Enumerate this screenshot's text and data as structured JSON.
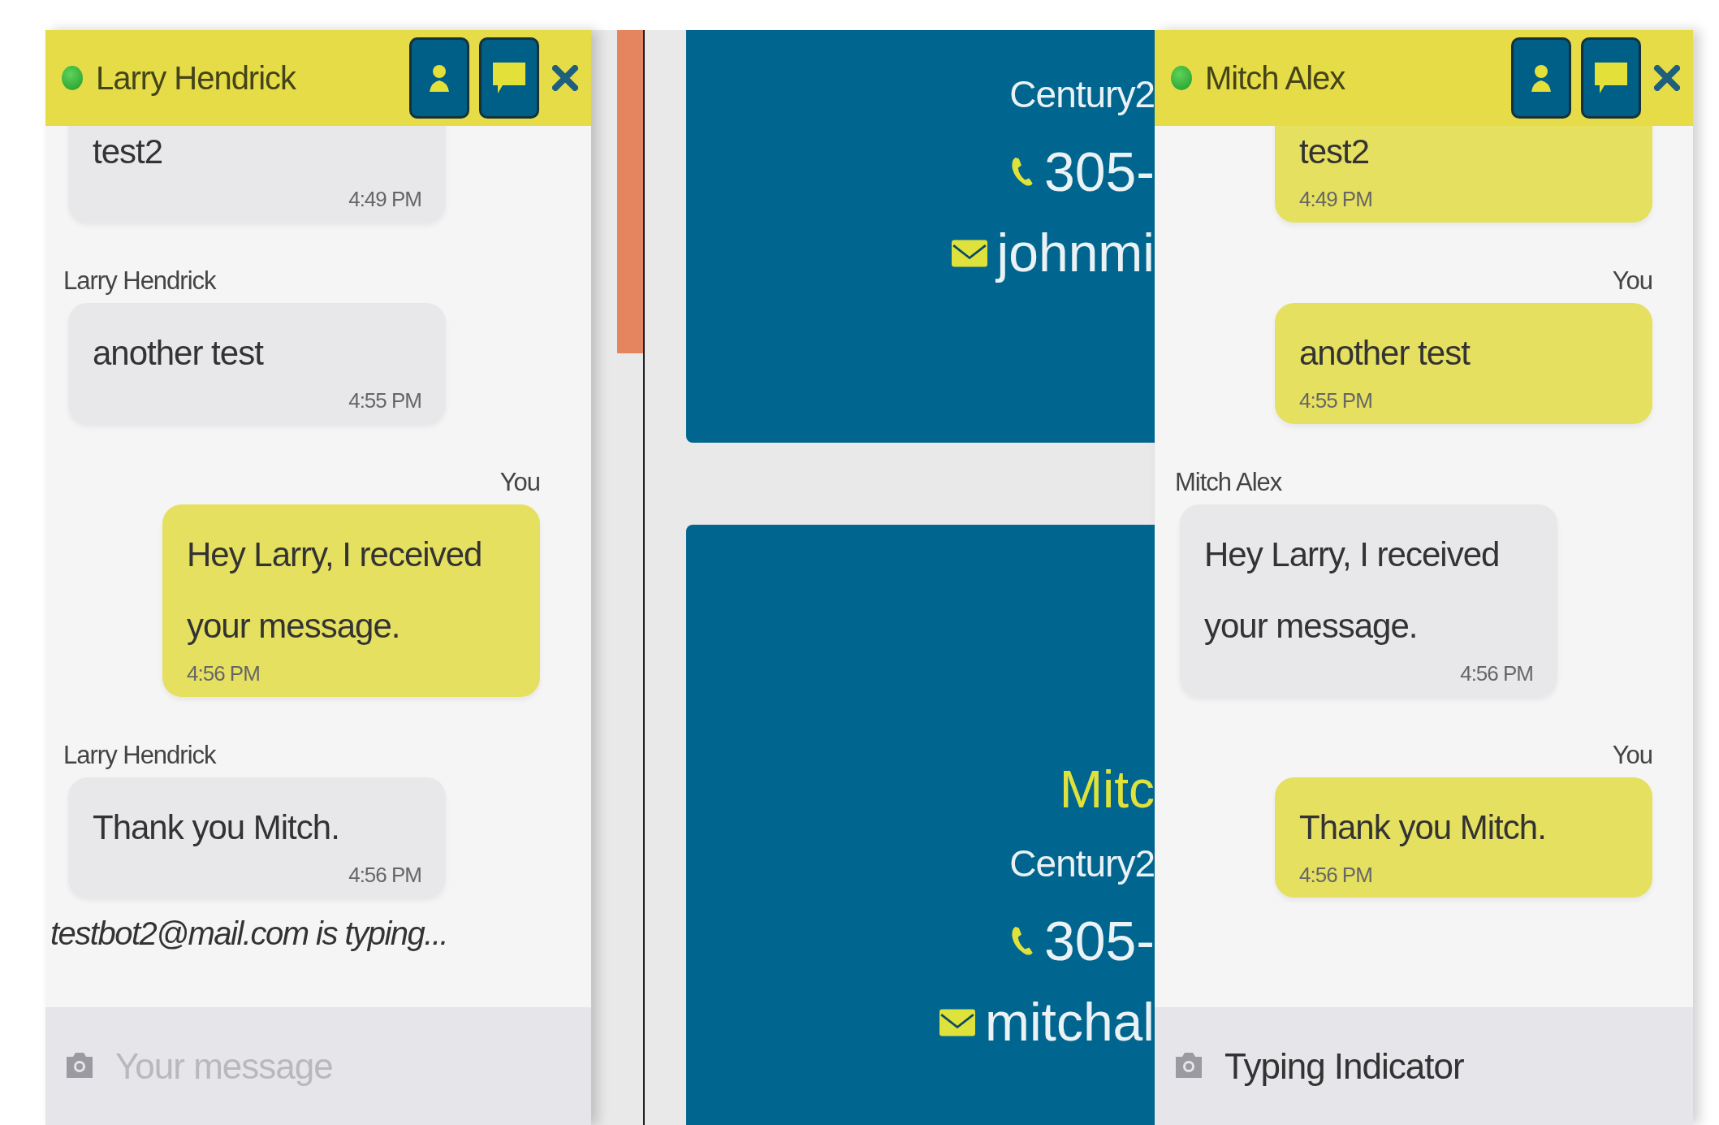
{
  "chat_windows": [
    {
      "contact": "Larry Hendrick",
      "online": true,
      "messages": [
        {
          "from_me": false,
          "text": "test2",
          "time": "4:49 PM"
        },
        {
          "from_me": false,
          "sender_label": "Larry Hendrick",
          "text": "another test",
          "time": "4:55 PM"
        },
        {
          "from_me": true,
          "sender_label": "You",
          "text": "Hey Larry, I received your message.",
          "time": "4:56 PM"
        },
        {
          "from_me": false,
          "sender_label": "Larry Hendrick",
          "text": "Thank you Mitch.",
          "time": "4:56 PM"
        }
      ],
      "typing_notice": "testbot2@mail.com is typing...",
      "composer": {
        "placeholder": "Your message"
      }
    },
    {
      "contact": "Mitch Alex",
      "online": true,
      "messages": [
        {
          "from_me": true,
          "text": "test2",
          "time": "4:49 PM"
        },
        {
          "from_me": true,
          "sender_label": "You",
          "text": "another test",
          "time": "4:55 PM"
        },
        {
          "from_me": false,
          "sender_label": "Mitch Alex",
          "text": "Hey Larry, I received your message.",
          "time": "4:56 PM"
        },
        {
          "from_me": true,
          "sender_label": "You",
          "text": "Thank you Mitch.",
          "time": "4:56 PM"
        }
      ],
      "composer": {
        "value": "Typing Indicator"
      }
    }
  ],
  "listing_cards": [
    {
      "lines": [
        {
          "kind": "company",
          "text": "Century2"
        },
        {
          "kind": "phone",
          "text": "305-"
        },
        {
          "kind": "email",
          "text": "johnmi"
        }
      ]
    },
    {
      "lines": [
        {
          "kind": "name",
          "text": "Mitc"
        },
        {
          "kind": "company",
          "text": "Century2"
        },
        {
          "kind": "phone",
          "text": "305-"
        },
        {
          "kind": "email",
          "text": "mitchal"
        }
      ]
    }
  ]
}
